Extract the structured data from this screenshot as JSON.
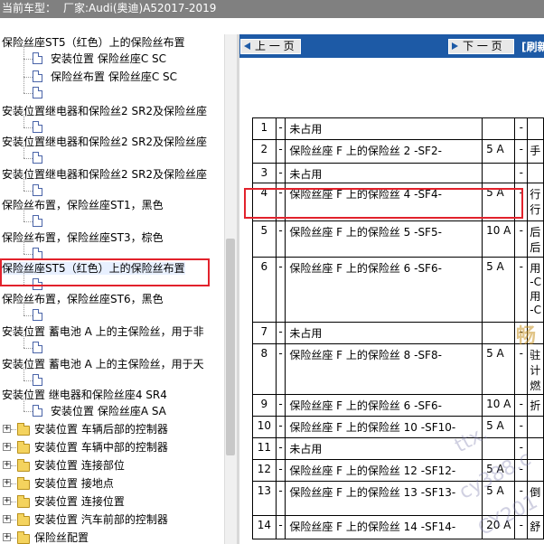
{
  "header": {
    "model_label": "当前车型：",
    "model_value": "厂家:Audi(奥迪)A52017-2019"
  },
  "tree": {
    "items": [
      {
        "label": "保险丝座ST5（红色）上的保险丝布置",
        "type": "text"
      },
      {
        "label": "安装位置 保险丝座C SC",
        "type": "doc"
      },
      {
        "label": "保险丝布置 保险丝座C SC",
        "type": "doc"
      },
      {
        "label": "",
        "type": "doc"
      },
      {
        "label": "安装位置继电器和保险丝2 SR2及保险丝座",
        "type": "text"
      },
      {
        "label": "",
        "type": "doc"
      },
      {
        "label": "安装位置继电器和保险丝2 SR2及保险丝座",
        "type": "text"
      },
      {
        "label": "",
        "type": "doc"
      },
      {
        "label": "安装位置继电器和保险丝2 SR2及保险丝座",
        "type": "text"
      },
      {
        "label": "",
        "type": "doc"
      },
      {
        "label": "保险丝布置，保险丝座ST1，黑色",
        "type": "text"
      },
      {
        "label": "",
        "type": "doc"
      },
      {
        "label": "保险丝布置，保险丝座ST3，棕色",
        "type": "text"
      },
      {
        "label": "",
        "type": "doc"
      },
      {
        "label": "保险丝座ST5（红色）上的保险丝布置",
        "type": "text",
        "selected": true
      },
      {
        "label": "",
        "type": "doc"
      },
      {
        "label": "保险丝布置，保险丝座ST6，黑色",
        "type": "text"
      },
      {
        "label": "",
        "type": "doc"
      },
      {
        "label": "安装位置 蓄电池 A 上的主保险丝，用于非",
        "type": "text"
      },
      {
        "label": "",
        "type": "doc"
      },
      {
        "label": "安装位置 蓄电池 A 上的主保险丝，用于天",
        "type": "text"
      },
      {
        "label": "",
        "type": "doc"
      },
      {
        "label": "安装位置 继电器和保险丝座4 SR4",
        "type": "text"
      },
      {
        "label": "安装位置 保险丝座A SA",
        "type": "doc"
      },
      {
        "label": "安装位置 车辆后部的控制器",
        "type": "folder"
      },
      {
        "label": "安装位置 车辆中部的控制器",
        "type": "folder"
      },
      {
        "label": "安装位置 连接部位",
        "type": "folder"
      },
      {
        "label": "安装位置 接地点",
        "type": "folder"
      },
      {
        "label": "安装位置 连接位置",
        "type": "folder"
      },
      {
        "label": "安装位置 汽车前部的控制器",
        "type": "folder"
      },
      {
        "label": "保险丝配置",
        "type": "folder"
      }
    ]
  },
  "nav": {
    "prev_label": "上 一 页",
    "next_label": "下 一 页",
    "refresh_label": "[刷新"
  },
  "fuse_table": {
    "rows": [
      {
        "no": "1",
        "dash": "-",
        "desc": "未占用",
        "amp": "",
        "dash2": "-",
        "note": ""
      },
      {
        "no": "2",
        "dash": "-",
        "desc": "保险丝座 F 上的保险丝 2 -SF2-",
        "amp": "5 A",
        "dash2": "-",
        "note": "手"
      },
      {
        "no": "3",
        "dash": "-",
        "desc": "未占用",
        "amp": "",
        "dash2": "-",
        "note": ""
      },
      {
        "no": "4",
        "dash": "-",
        "desc": "保险丝座 F 上的保险丝 4 -SF4-",
        "amp": "5 A",
        "dash2": "-",
        "note": "行\n行"
      },
      {
        "no": "5",
        "dash": "-",
        "desc": "保险丝座 F 上的保险丝 5 -SF5-",
        "amp": "10 A",
        "dash2": "-",
        "note": "后\n后"
      },
      {
        "no": "6",
        "dash": "-",
        "desc": "保险丝座 F 上的保险丝 6 -SF6-",
        "amp": "5 A",
        "dash2": "-",
        "note": "用\n-C\n用\n-C"
      },
      {
        "no": "7",
        "dash": "-",
        "desc": "未占用",
        "amp": "",
        "dash2": "-",
        "note": ""
      },
      {
        "no": "8",
        "dash": "-",
        "desc": "保险丝座 F 上的保险丝 8 -SF8-",
        "amp": "5 A",
        "dash2": "-",
        "note": "驻\n计\n燃"
      },
      {
        "no": "9",
        "dash": "-",
        "desc": "保险丝座 F 上的保险丝 6 -SF6-",
        "amp": "10 A",
        "dash2": "-",
        "note": "折"
      },
      {
        "no": "10",
        "dash": "-",
        "desc": "保险丝座 F 上的保险丝 10 -SF10-",
        "amp": "5 A",
        "dash2": "-",
        "note": ""
      },
      {
        "no": "11",
        "dash": "-",
        "desc": "未占用",
        "amp": "",
        "dash2": "-",
        "note": ""
      },
      {
        "no": "12",
        "dash": "-",
        "desc": "保险丝座 F 上的保险丝 12 -SF12-",
        "amp": "5 A",
        "dash2": "-",
        "note": ""
      },
      {
        "no": "13",
        "dash": "-",
        "desc": "保险丝座 F 上的保险丝 13 -SF13-",
        "amp": "5 A",
        "dash2": "-",
        "note": "倒"
      },
      {
        "no": "14",
        "dash": "-",
        "desc": "保险丝座 F 上的保险丝 14 -SF14-",
        "amp": "20 A",
        "dash2": "-",
        "note": "舒"
      }
    ]
  },
  "watermarks": {
    "gold": "畅",
    "w1": "ttx.",
    "w2": "cy388.c",
    "w3": "CY201"
  }
}
